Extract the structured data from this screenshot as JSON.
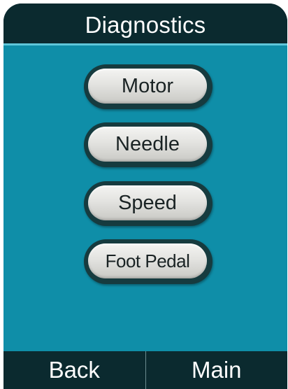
{
  "header": {
    "title": "Diagnostics"
  },
  "menu": {
    "items": [
      {
        "label": "Motor"
      },
      {
        "label": "Needle"
      },
      {
        "label": "Speed"
      },
      {
        "label": "Foot Pedal"
      }
    ]
  },
  "footer": {
    "back_label": "Back",
    "main_label": "Main"
  },
  "colors": {
    "frame": "#0b2a2f",
    "content_background": "#0f8ea8",
    "button_ring": "#163b3f",
    "button_face": "#e3e3e0",
    "text_light": "#ffffff",
    "text_dark": "#1a2324"
  }
}
